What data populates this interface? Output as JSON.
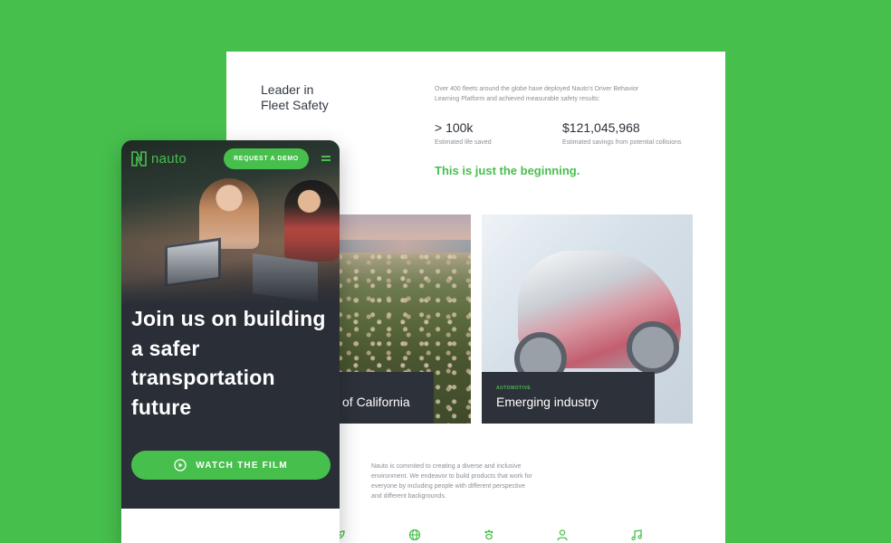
{
  "desktop": {
    "leader_title_line1": "Leader in",
    "leader_title_line2": "Fleet Safety",
    "intro_text": "Over 400 fleets around the globe have deployed Nauto's Driver Behavior Learning Platform and achieved measurable safety results:",
    "stats": [
      {
        "value": "> 100k",
        "label": "Estimated life saved"
      },
      {
        "value": "$121,045,968",
        "label": "Estimated savings from potential collisions"
      }
    ],
    "beginning_text": "This is just the beginning.",
    "cards": [
      {
        "title": "of California"
      },
      {
        "tag": "AUTOMOTIVE",
        "title": "Emerging industry"
      }
    ],
    "diversity_text": "Nauto is commited to creating a diverse and inclusive environment. We endeavor to build products that work for everyone by including people with different perspective and different backgrounds.",
    "bottom_icons": [
      "leaf-icon",
      "globe-icon",
      "paw-icon",
      "person-icon",
      "music-icon"
    ]
  },
  "phone": {
    "logo_text": "nauto",
    "request_demo_label": "REQUEST A DEMO",
    "headline": "Join us on building a safer transportation future",
    "watch_film_label": "WATCH THE FILM"
  },
  "colors": {
    "brand_green": "#47bf4d",
    "dark": "#2a2f37",
    "caption_bg": "#2d3139"
  }
}
